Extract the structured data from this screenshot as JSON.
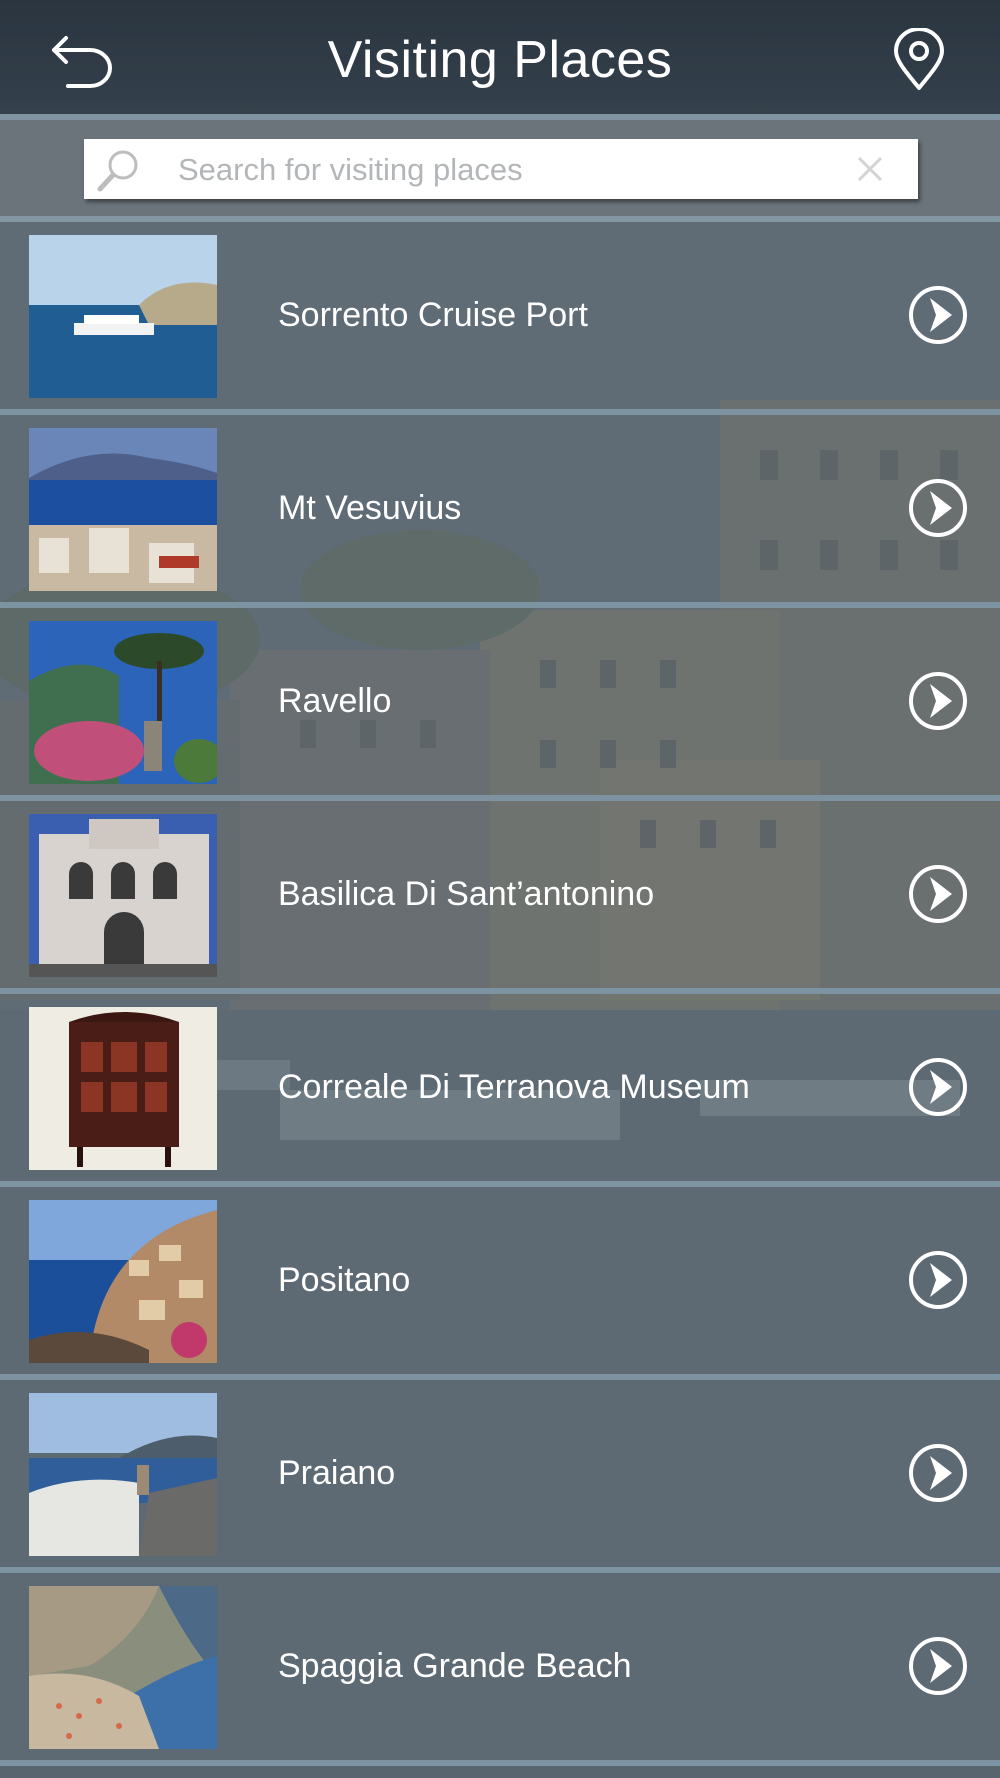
{
  "header": {
    "title": "Visiting Places",
    "back_icon": "back-arrow-icon",
    "location_icon": "map-pin-icon"
  },
  "search": {
    "placeholder": "Search for visiting places",
    "value": "",
    "search_icon": "magnifier-icon",
    "clear_icon": "clear-x-icon"
  },
  "places": [
    {
      "name": "Sorrento Cruise Port",
      "thumb": "cruise-ship-photo"
    },
    {
      "name": "Mt Vesuvius",
      "thumb": "vesuvius-bay-photo"
    },
    {
      "name": "Ravello",
      "thumb": "ravello-garden-photo"
    },
    {
      "name": "Basilica Di Sant’antonino",
      "thumb": "basilica-facade-photo"
    },
    {
      "name": "Correale Di Terranova Museum",
      "thumb": "museum-cabinet-photo"
    },
    {
      "name": "Positano",
      "thumb": "positano-coast-photo"
    },
    {
      "name": "Praiano",
      "thumb": "praiano-terrace-photo"
    },
    {
      "name": "Spaggia Grande Beach",
      "thumb": "beach-photo"
    }
  ],
  "colors": {
    "header_bg": "#2f3a45",
    "divider": "#7e93a2",
    "row_overlay": "#5f6c76",
    "text": "#ffffff"
  }
}
